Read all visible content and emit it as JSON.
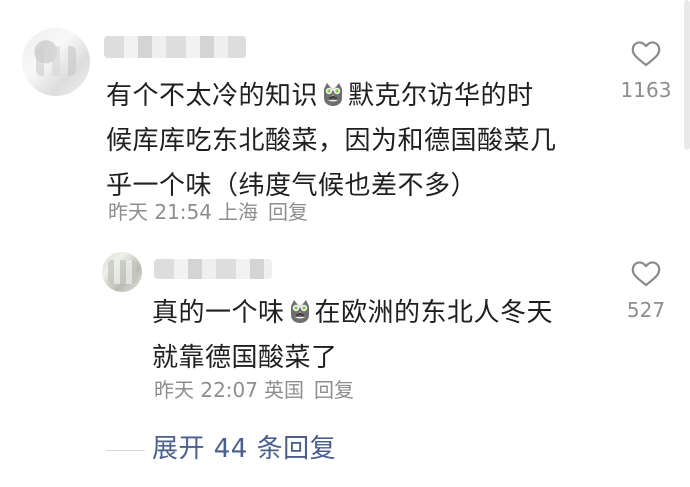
{
  "comments": [
    {
      "text_part1": "有个不太冷的知识",
      "text_part2": "默克尔访华的时\n候库库吃东北酸菜，因为和德国酸菜几\n乎一个味（纬度气候也差不多）",
      "time": "昨天 21:54",
      "location": "上海",
      "reply_label": "回复",
      "likes": "1163",
      "emoji_icon": "cat-emoji-icon"
    },
    {
      "text_part1": "真的一个味",
      "text_part2": "在欧洲的东北人冬天\n就靠德国酸菜了",
      "time": "昨天 22:07",
      "location": "英国",
      "reply_label": "回复",
      "likes": "527",
      "emoji_icon": "cat-emoji-icon"
    }
  ],
  "expand": {
    "label": "展开 44 条回复"
  },
  "colors": {
    "text": "#1f1f1f",
    "meta": "#8e8e8e",
    "link": "#4b5f8f",
    "icon": "#8a8a8a"
  }
}
